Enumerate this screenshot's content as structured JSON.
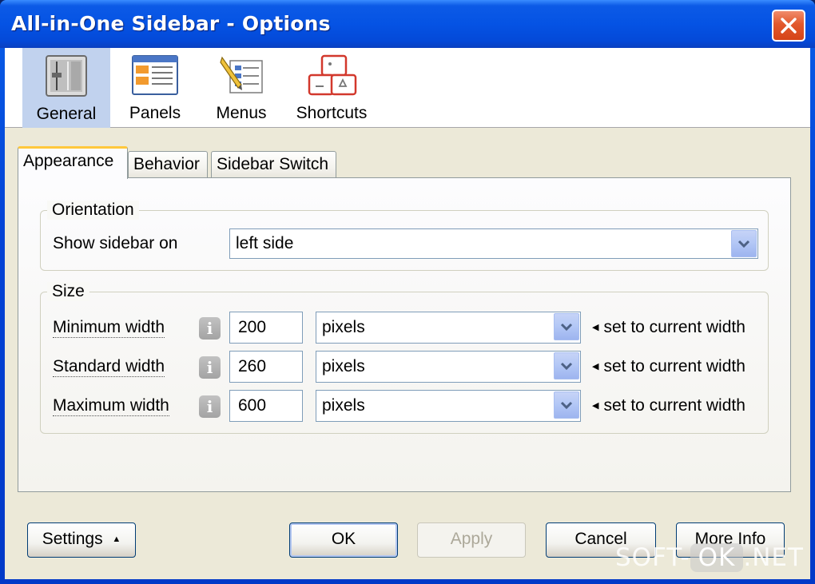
{
  "window": {
    "title": "All-in-One Sidebar - Options"
  },
  "toolbar": {
    "items": [
      {
        "label": "General",
        "icon": "general-sliders-icon",
        "selected": true
      },
      {
        "label": "Panels",
        "icon": "panels-window-icon",
        "selected": false
      },
      {
        "label": "Menus",
        "icon": "menus-pencil-icon",
        "selected": false
      },
      {
        "label": "Shortcuts",
        "icon": "shortcuts-keys-icon",
        "selected": false
      }
    ]
  },
  "tabs": [
    {
      "label": "Appearance",
      "active": true
    },
    {
      "label": "Behavior",
      "active": false
    },
    {
      "label": "Sidebar Switch",
      "active": false
    }
  ],
  "orientation": {
    "title": "Orientation",
    "show_label": "Show sidebar on",
    "show_value": "left side"
  },
  "size": {
    "title": "Size",
    "rows": [
      {
        "label": "Minimum width",
        "value": "200",
        "unit": "pixels",
        "action": "set to current width"
      },
      {
        "label": "Standard width",
        "value": "260",
        "unit": "pixels",
        "action": "set to current width"
      },
      {
        "label": "Maximum width",
        "value": "600",
        "unit": "pixels",
        "action": "set to current width"
      }
    ]
  },
  "buttons": {
    "settings": "Settings",
    "ok": "OK",
    "apply": "Apply",
    "cancel": "Cancel",
    "more_info": "More Info"
  },
  "watermark": {
    "left": "SOFT-",
    "pill": "OK",
    "right": ".NET"
  },
  "colors": {
    "titlebar": "#0553e4",
    "close": "#e2582c",
    "panel": "#ece9d8",
    "tab_highlight": "#ffc83c",
    "selected_tool": "#c1d2ee"
  }
}
